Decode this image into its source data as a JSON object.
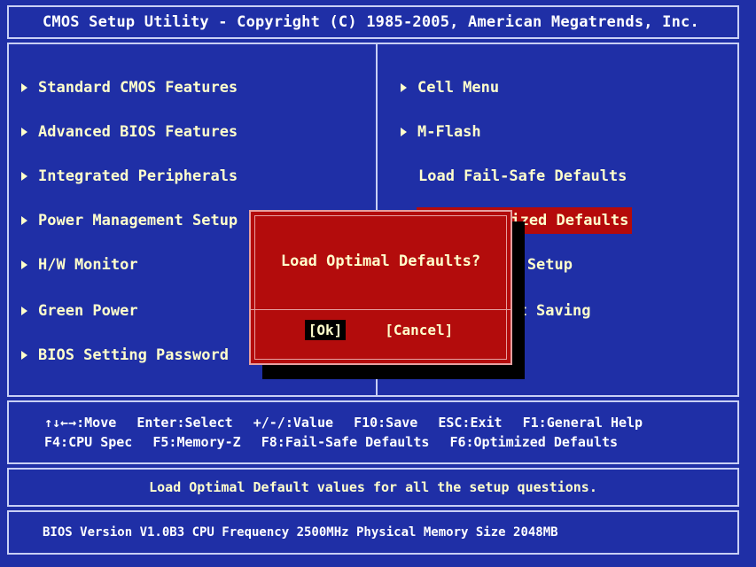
{
  "title": "CMOS Setup Utility - Copyright (C) 1985-2005, American Megatrends, Inc.",
  "left_menu": [
    {
      "label": "Standard CMOS Features",
      "arrow": true
    },
    {
      "label": "Advanced BIOS Features",
      "arrow": true
    },
    {
      "label": "Integrated Peripherals",
      "arrow": true
    },
    {
      "label": "Power Management Setup",
      "arrow": true
    },
    {
      "label": "H/W Monitor",
      "arrow": true
    },
    {
      "label": "Green Power",
      "arrow": true
    },
    {
      "label": "BIOS Setting Password",
      "arrow": true
    }
  ],
  "right_menu": [
    {
      "label": "Cell Menu",
      "arrow": true
    },
    {
      "label": "M-Flash",
      "arrow": true
    },
    {
      "label": "Load Fail-Safe Defaults",
      "arrow": false
    },
    {
      "label": "Load Optimized Defaults",
      "arrow": false,
      "selected": true
    },
    {
      "label": "Save & Exit Setup",
      "arrow": false
    },
    {
      "label": "Exit Without Saving",
      "arrow": false
    }
  ],
  "help": {
    "line1": [
      "↑↓←→:Move",
      "Enter:Select",
      "+/-/:Value",
      "F10:Save",
      "ESC:Exit",
      "F1:General Help"
    ],
    "line2": [
      "F4:CPU Spec",
      "F5:Memory-Z",
      "F8:Fail-Safe Defaults",
      "F6:Optimized Defaults"
    ]
  },
  "description": "Load Optimal Default values for all the setup questions.",
  "version_line": "BIOS Version V1.0B3 CPU Frequency 2500MHz Physical Memory Size 2048MB",
  "dialog": {
    "question": "Load Optimal Defaults?",
    "ok_label": "[Ok]",
    "cancel_label": "[Cancel]"
  },
  "colors": {
    "background": "#1f2fa6",
    "dialog": "#b30c0c",
    "highlight": "#b50a0a",
    "text": "#ffffcc"
  }
}
